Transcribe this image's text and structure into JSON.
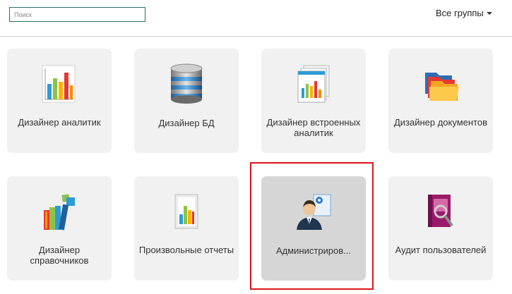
{
  "header": {
    "search_placeholder": "Поиск",
    "groups_label": "Все группы"
  },
  "tiles": [
    {
      "label": "Дизайнер аналитик",
      "icon": "bar-chart-icon"
    },
    {
      "label": "Дизайнер БД",
      "icon": "database-icon"
    },
    {
      "label": "Дизайнер встроенных аналитик",
      "icon": "embedded-report-icon"
    },
    {
      "label": "Дизайнер документов",
      "icon": "folders-icon"
    },
    {
      "label": "Дизайнер справочников",
      "icon": "books-icon"
    },
    {
      "label": "Произвольные отчеты",
      "icon": "report-chart-icon"
    },
    {
      "label": "Администриров...",
      "icon": "admin-user-icon",
      "selected": true
    },
    {
      "label": "Аудит пользователей",
      "icon": "audit-book-icon"
    }
  ],
  "colors": {
    "highlight": "#d9161b",
    "tile_bg": "#f1f1f1",
    "tile_selected_bg": "#d6d6d6"
  }
}
